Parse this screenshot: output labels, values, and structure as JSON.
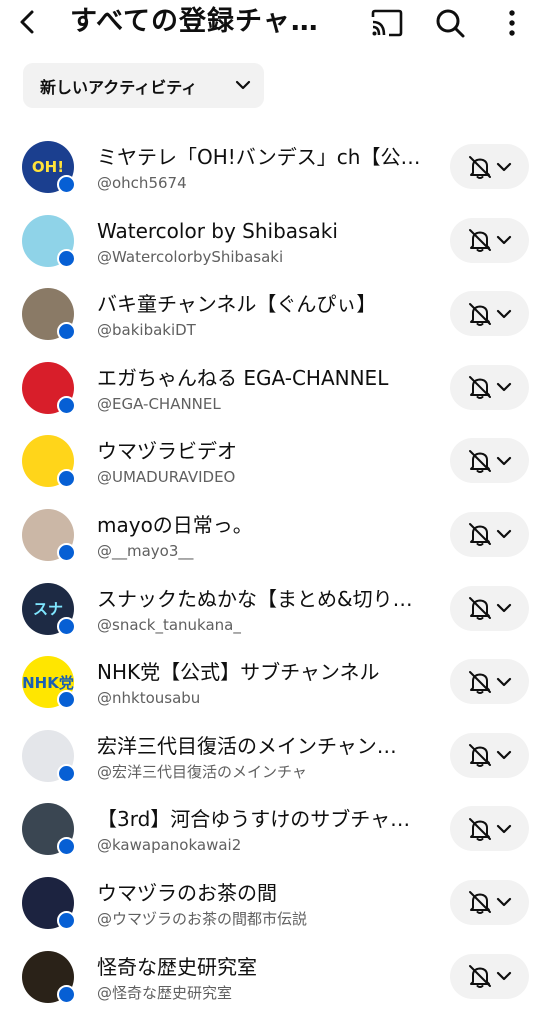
{
  "header": {
    "title": "すべての登録チャ…",
    "back_icon": "arrow-left-icon",
    "cast_icon": "cast-icon",
    "search_icon": "search-icon",
    "more_icon": "more-vertical-icon"
  },
  "filter": {
    "label": "新しいアクティビティ",
    "icon": "chevron-down-icon"
  },
  "channels": [
    {
      "name": "ミヤテレ「OH!バンデス」ch【公…",
      "handle": "@ohch5674",
      "avatar_text": "OH!",
      "avatar_color": "#1b3f8f",
      "avatar_fg": "#ffe23a"
    },
    {
      "name": "Watercolor by Shibasaki",
      "handle": "@WatercolorbyShibasaki",
      "avatar_text": "",
      "avatar_color": "#8fd3e8",
      "avatar_fg": "#ffffff"
    },
    {
      "name": "バキ童チャンネル【ぐんぴぃ】",
      "handle": "@bakibakiDT",
      "avatar_text": "",
      "avatar_color": "#8a7a66",
      "avatar_fg": "#ffffff"
    },
    {
      "name": "エガちゃんねる EGA-CHANNEL",
      "handle": "@EGA-CHANNEL",
      "avatar_text": "",
      "avatar_color": "#d81e2a",
      "avatar_fg": "#ffffff"
    },
    {
      "name": "ウマヅラビデオ",
      "handle": "@UMADURAVIDEO",
      "avatar_text": "",
      "avatar_color": "#ffd51a",
      "avatar_fg": "#7a3ea0"
    },
    {
      "name": "mayoの日常っ。",
      "handle": "@__mayo3__",
      "avatar_text": "",
      "avatar_color": "#cbb7a6",
      "avatar_fg": "#ffffff"
    },
    {
      "name": "スナックたぬかな【まとめ&切り…",
      "handle": "@snack_tanukana_",
      "avatar_text": "スナ",
      "avatar_color": "#1d2a44",
      "avatar_fg": "#7fe6ff"
    },
    {
      "name": "NHK党【公式】サブチャンネル",
      "handle": "@nhktousabu",
      "avatar_text": "NHK党",
      "avatar_color": "#ffe600",
      "avatar_fg": "#1a5fb4"
    },
    {
      "name": "宏洋三代目復活のメインチャン…",
      "handle": "@宏洋三代目復活のメインチャ",
      "avatar_text": "",
      "avatar_color": "#e4e6ea",
      "avatar_fg": "#333333"
    },
    {
      "name": "【3rd】河合ゆうすけのサブチャ…",
      "handle": "@kawapanokawai2",
      "avatar_text": "",
      "avatar_color": "#3a4652",
      "avatar_fg": "#ffffff"
    },
    {
      "name": "ウマヅラのお茶の間",
      "handle": "@ウマヅラのお茶の間都市伝説",
      "avatar_text": "",
      "avatar_color": "#1c2340",
      "avatar_fg": "#f2c230"
    },
    {
      "name": "怪奇な歴史研究室",
      "handle": "@怪奇な歴史研究室",
      "avatar_text": "",
      "avatar_color": "#2a2218",
      "avatar_fg": "#e8d9a8"
    }
  ],
  "row_icons": {
    "bell": "bell-off-icon",
    "chevron": "chevron-down-icon"
  },
  "colors": {
    "new_dot": "#065fd4",
    "chip_bg": "#f2f2f2",
    "secondary_text": "#606060"
  }
}
